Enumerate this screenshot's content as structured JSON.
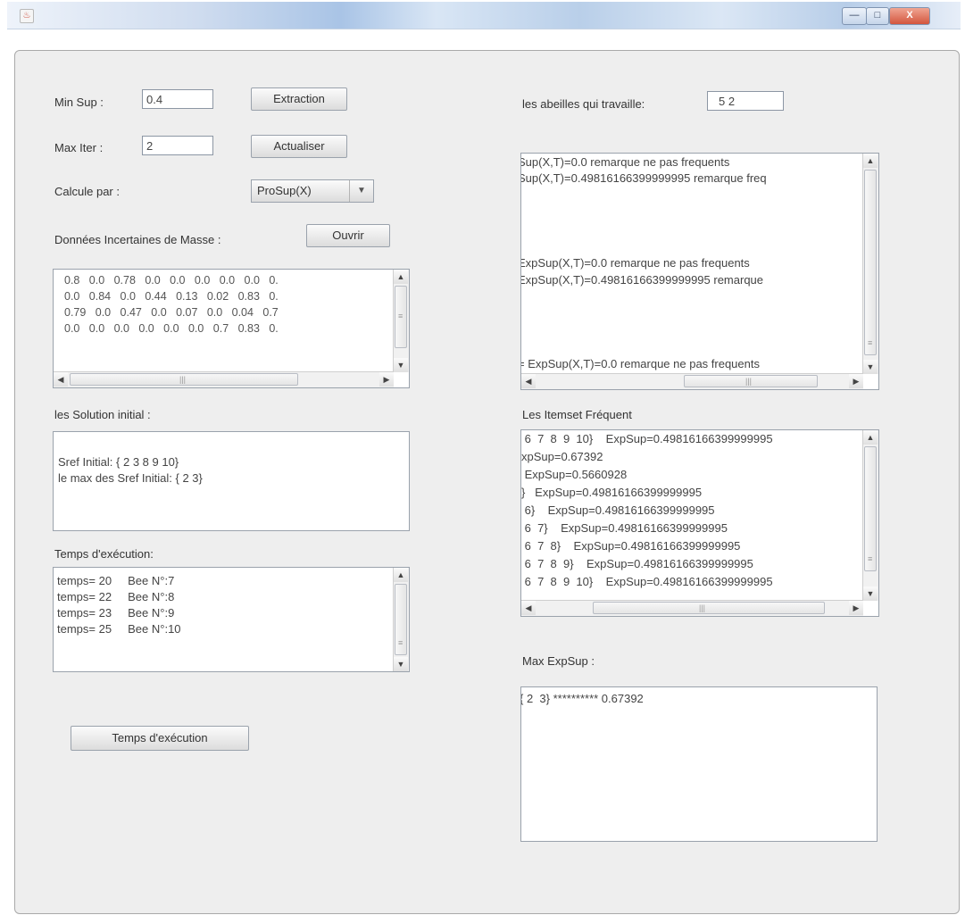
{
  "window": {
    "icon": "java-cup-icon",
    "controls": {
      "minimize": "—",
      "maximize": "□",
      "close": "X"
    }
  },
  "form": {
    "min_sup_label": "Min Sup :",
    "min_sup_value": "0.4",
    "max_iter_label": "Max Iter :",
    "max_iter_value": "2",
    "calcule_label": "Calcule par :",
    "calcule_value": "ProSup(X)",
    "donnees_label": "Données Incertaines de Masse :",
    "extraction_button": "Extraction",
    "actualiser_button": "Actualiser",
    "ouvrir_button": "Ouvrir"
  },
  "matrix_rows": [
    "0.8   0.0   0.78   0.0   0.0   0.0   0.0   0.0   0.",
    "0.0   0.84   0.0   0.44   0.13   0.02   0.83   0.",
    "0.79   0.0   0.47   0.0   0.07   0.0   0.04   0.7",
    "0.0   0.0   0.0   0.0   0.0   0.0   0.7   0.83   0."
  ],
  "solution": {
    "label": "les Solution initial :",
    "lines": [
      "Sref Initial: { 2  3  8  9  10}",
      "le max des Sref Initial: { 2  3}"
    ]
  },
  "temps": {
    "label": "Temps d'exécution:",
    "lines": [
      "temps= 20     Bee N°:7",
      "temps= 22     Bee N°:8",
      "temps= 23     Bee N°:9",
      "temps= 25     Bee N°:10"
    ],
    "button": "Temps d'exécution"
  },
  "abeilles": {
    "label": "les abeilles qui travaille:",
    "value": "5  2"
  },
  "log_lines": [
    "Sup(X,T)=0.0 remarque  ne pas  frequents",
    "Sup(X,T)=0.49816166399999995 remarque  freq",
    "ExpSup(X,T)=0.0 remarque  ne pas  frequents",
    " ExpSup(X,T)=0.49816166399999995 remarque",
    "=  ExpSup(X,T)=0.0 remarque  ne pas  frequents"
  ],
  "itemset": {
    "label": "Les Itemset Fréquent",
    "lines": [
      " 6  7  8  9  10}    ExpSup=0.49816166399999995",
      "xpSup=0.67392",
      " ExpSup=0.5660928",
      "}   ExpSup=0.49816166399999995",
      " 6}    ExpSup=0.49816166399999995",
      " 6  7}    ExpSup=0.49816166399999995",
      " 6  7  8}    ExpSup=0.49816166399999995",
      " 6  7  8  9}    ExpSup=0.49816166399999995",
      " 6  7  8  9  10}    ExpSup=0.49816166399999995"
    ]
  },
  "max_expsup": {
    "label": "Max ExpSup :",
    "value": "{ 2  3} ********** 0.67392"
  }
}
